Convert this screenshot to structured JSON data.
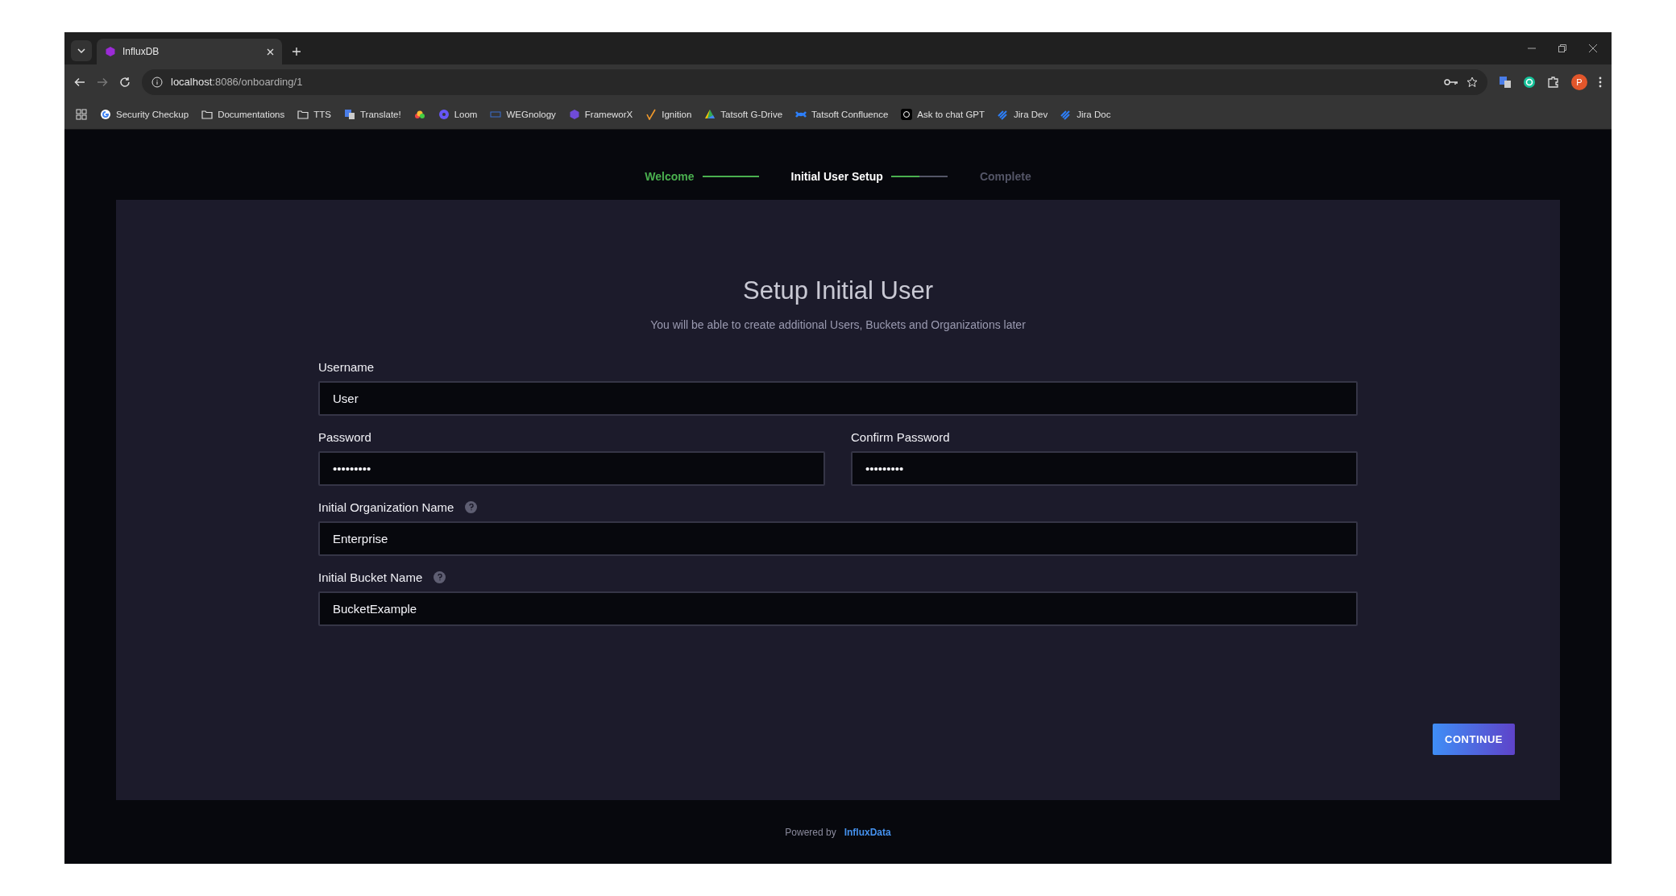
{
  "browser": {
    "tab": {
      "title": "InfluxDB",
      "selected": true
    },
    "address": {
      "host": "localhost",
      "path": ":8086/onboarding/1"
    },
    "bookmarks": [
      {
        "label": "Security Checkup",
        "kind": "google"
      },
      {
        "label": "Documentations",
        "kind": "folder"
      },
      {
        "label": "TTS",
        "kind": "folder"
      },
      {
        "label": "Translate!",
        "kind": "translate"
      },
      {
        "kind": "cloud"
      },
      {
        "label": "Loom",
        "kind": "loom"
      },
      {
        "label": "WEGnology",
        "kind": "weg"
      },
      {
        "label": "FrameworX",
        "kind": "hex"
      },
      {
        "label": "Ignition",
        "kind": "ignition"
      },
      {
        "label": "Tatsoft G-Drive",
        "kind": "drive"
      },
      {
        "label": "Tatsoft Confluence",
        "kind": "confluence"
      },
      {
        "label": "Ask to chat GPT",
        "kind": "chatgpt"
      },
      {
        "label": "Jira Dev",
        "kind": "jira"
      },
      {
        "label": "Jira Doc",
        "kind": "jira"
      }
    ],
    "profile": "P"
  },
  "steps": [
    {
      "label": "Welcome",
      "selected": false,
      "level": 1
    },
    {
      "label": "Initial User Setup",
      "selected": true,
      "level": 0.5
    },
    {
      "label": "Complete",
      "selected": false
    }
  ],
  "form": {
    "title": "Setup Initial User",
    "subtitle": "You will be able to create additional Users, Buckets and Organizations later",
    "rows": [
      [
        {
          "label": "Username",
          "value": "User",
          "help": false
        }
      ],
      [
        {
          "label": "Password",
          "value": "•••••••••",
          "help": false
        },
        {
          "label": "Confirm Password",
          "value": "•••••••••",
          "help": false
        }
      ],
      [
        {
          "label": "Initial Organization Name",
          "value": "Enterprise",
          "help": true
        }
      ],
      [
        {
          "label": "Initial Bucket Name",
          "value": "BucketExample",
          "help": true
        }
      ]
    ],
    "button": "CONTINUE"
  },
  "footer": {
    "text": "Powered by",
    "link": "InfluxData"
  }
}
